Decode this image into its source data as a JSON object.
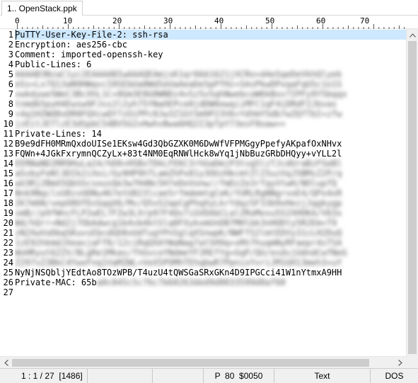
{
  "tab": {
    "label": "1.. OpenStack.ppk"
  },
  "ruler": {
    "labels": [
      "0",
      "10",
      "20",
      "30",
      "40",
      "50",
      "60",
      "70"
    ]
  },
  "editor": {
    "line_numbers": [
      "1",
      "2",
      "3",
      "4",
      "5",
      "6",
      "7",
      "8",
      "9",
      "10",
      "11",
      "12",
      "13",
      "14",
      "15",
      "16",
      "17",
      "18",
      "19",
      "20",
      "21",
      "22",
      "23",
      "24",
      "25",
      "26",
      "27"
    ],
    "lines": [
      {
        "text": "PuTTY-User-Key-File-2: ssh-rsa"
      },
      {
        "text": "Encryption: aes256-cbc"
      },
      {
        "text": "Comment: imported-openssh-key"
      },
      {
        "text": "Public-Lines: 6"
      },
      {
        "text": "",
        "blurred": "AAAAB3NzaC1yc2EAAAABIwAAAQEAmjsK1qr66A1621jXCRo+d4eSqeDeVkhQlyek"
      },
      {
        "text": "",
        "blurred": "eSs+Lx7Q13aN9HWqvcI0SEbUa0Wd5eUaAeaDe5pPfHz+SAsPkwDPxqaFqUSc1o1S"
      },
      {
        "text": "",
        "blurred": "vwkdywe5WeC3BcXhL1C+8Gm3E8G0WNDz4vSz5vSqhNwebcoW6kBxv7IPFy9Y5bqqx"
      },
      {
        "text": "",
        "blurred": "tnmdb5pyH4Ewsw9FJss2l2yh75YNaOEPce0jdDW0owqiiMFC1qF4iDRdF2Jbvas"
      },
      {
        "text": "",
        "blurred": "+4q1HZWd8xDR0FQXcwQY7zUiPPc8Jw3Z1GtSm9P23V6+YdVmY5db7wZQfTbI+zfw"
      },
      {
        "text": "",
        "blurred": "jzEitJETlzE3dSpbC54BV5G2vHwhvBwa6HQ2I3pTpY73esF8oaw=="
      },
      {
        "text": "Private-Lines: 14"
      },
      {
        "text": "B9e9dFH0MRmQxdoUISe1EKsw4Gd3QbGZXK0M6DwWfVFPMGgyPpefyAKpafOxNHvx"
      },
      {
        "text": "FQWn+4JGkFxrymnQCZyLx+83t4NM0EqRNWlHck8wYq1jNbBuzGRbDHQyy+vYLL2l"
      },
      {
        "text": "",
        "blurred": "EERNaND2RR9HuLa24/hD0+H5BxTDkLFEKC3rhGaDmjP3tvg5lzTJcdUraBzFSeBl"
      },
      {
        "text": "",
        "blurred": "aSvbyFeNl3DIk2iXoi/Gy9HP9hTLamZhPx81y3OUzHkcmtZlI5uzVqJ5BMsZ2P/q"
      },
      {
        "text": "",
        "blurred": "wU3Rj2BmX5QbSScsousQe3w7H4Nc5H7eDoVonw//fmDzZe3rTqyVtwH/NOlupfQ"
      },
      {
        "text": "",
        "blurred": "Nnk9NqclsU8zvUDNu467etU823lcae5rfmdemtgCeK/YURLRgNNgrvoE4/QPx4xR"
      },
      {
        "text": "",
        "blurred": "IK7m6N/vepO8OfDzGqqX6/Mv/Q5vS2apCgPhqXyLkrYdqz5F33b9xHezjJqgkygp"
      },
      {
        "text": "",
        "blurred": "smB//p9fWncFLP2wEL7FZw3LXrp97F4Qv7iGVDAbCLalZRoMosu5S2XHOKA/V63x"
      },
      {
        "text": "",
        "blurred": "Wd/hQrr+Nd2j7ObAdwcg1b4vb4ktSlq0FXykxmUnDB7MHlbk3nHODty5R2Em+T9"
      },
      {
        "text": "",
        "blurred": "zN2XwVoDbqSKuvsEbcdGD8xUdTugYPnSglqXSnwpK/NWFfS2lmtEDVy31cLH2DuQ"
      },
      {
        "text": "",
        "blurred": "1zE92hkmdJXeavjaFf8/12ciRqQXAYWaNag7at5H9q+xRh7huqmNyRFaepr4sTSA"
      },
      {
        "text": "",
        "blurred": "WoHRyut6ZZV/BLgRe1Mkas/fhGvcoYNdmeYF2REfYg+GqP/QU/esdvjUdndCwfNeG"
      },
      {
        "text": "",
        "blurred": "Z297vZ3BkC4YwxFnq1VaMZWL+VeX5POMhTEhqbwR7PpnixYvriJM1GH13meh3+uY"
      },
      {
        "text": "NyNjNSQbljYEdtAo8TOzWPB/T4uzU4tQWSGaSRxGKn4D9IPGCci41W1nYtmxA9HH"
      },
      {
        "text": "Private-MAC: 65b",
        "blurred": "a0c045c5c76c7b68263ded9d8833599d8af60"
      },
      {
        "text": ""
      }
    ]
  },
  "statusbar": {
    "position": "1 : 1 / 27  [1486]",
    "mode": "P  80  $0050",
    "type": "Text",
    "eol": "DOS"
  }
}
